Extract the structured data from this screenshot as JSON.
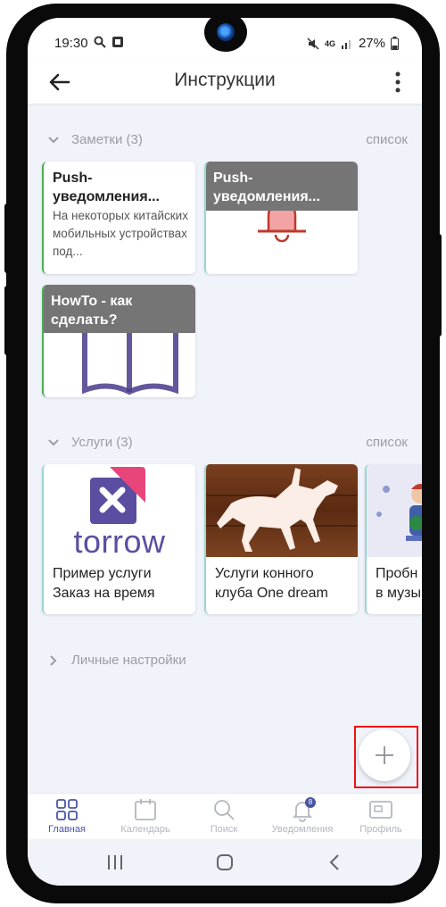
{
  "status_bar": {
    "time": "19:30",
    "battery": "27%",
    "network": "4G"
  },
  "app_bar": {
    "title": "Инструкции"
  },
  "notes_section": {
    "title": "Заметки (3)",
    "view_link": "список",
    "cards": [
      {
        "title": "Push-уведомления...",
        "text": "На некоторых китайских мобильных устройствах под..."
      },
      {
        "title": "Push-уведомления...",
        "icon": "bell-icon"
      },
      {
        "title": "HowTo - как сделать?",
        "icon": "book-icon"
      }
    ]
  },
  "services_section": {
    "title": "Услуги (3)",
    "view_link": "список",
    "cards": [
      {
        "logo_text": "torrow",
        "title_line1": "Пример услуги",
        "title_line2": "Заказ на время"
      },
      {
        "title_line1": "Услуги конного",
        "title_line2": "клуба One dream"
      },
      {
        "title_line1": "Пробн",
        "title_line2": "в музы"
      }
    ]
  },
  "personal_section": {
    "title": "Личные настройки"
  },
  "bottom_nav": {
    "items": [
      {
        "label": "Главная"
      },
      {
        "label": "Календарь"
      },
      {
        "label": "Поиск"
      },
      {
        "label": "Уведомления",
        "badge": "8"
      },
      {
        "label": "Профиль"
      }
    ]
  },
  "colors": {
    "accent": "#4a55a2",
    "note_border": "#4caf50",
    "fab_highlight": "#e11111",
    "bell": "#c0392b",
    "torrow_pink": "#e8457a",
    "torrow_purple": "#5b4ea1"
  }
}
